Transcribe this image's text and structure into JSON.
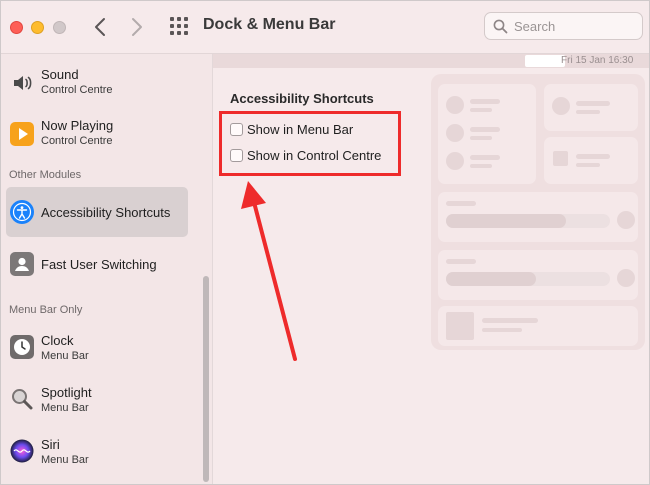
{
  "window": {
    "title": "Dock & Menu Bar"
  },
  "search": {
    "placeholder": "Search"
  },
  "sidebar": {
    "items_top": [
      {
        "name": "Sound",
        "sub": "Control Centre",
        "icon": "speaker-icon"
      },
      {
        "name": "Now Playing",
        "sub": "Control Centre",
        "icon": "play-icon"
      }
    ],
    "section_other": "Other Modules",
    "items_other": [
      {
        "name": "Accessibility Shortcuts",
        "icon": "accessibility-icon",
        "selected": true
      },
      {
        "name": "Fast User Switching",
        "icon": "user-icon"
      }
    ],
    "section_menubar": "Menu Bar Only",
    "items_menubar": [
      {
        "name": "Clock",
        "sub": "Menu Bar",
        "icon": "clock-icon"
      },
      {
        "name": "Spotlight",
        "sub": "Menu Bar",
        "icon": "magnifier-icon"
      },
      {
        "name": "Siri",
        "sub": "Menu Bar",
        "icon": "siri-icon"
      }
    ]
  },
  "content": {
    "menubar_date": "Fri 15 Jan  16:30",
    "group_title": "Accessibility Shortcuts",
    "options": [
      {
        "label": "Show in Menu Bar",
        "checked": false
      },
      {
        "label": "Show in Control Centre",
        "checked": false
      }
    ]
  },
  "colors": {
    "accent": "#1a82fb",
    "highlight_red": "#ee2b2b",
    "background": "#f6eaeb"
  }
}
